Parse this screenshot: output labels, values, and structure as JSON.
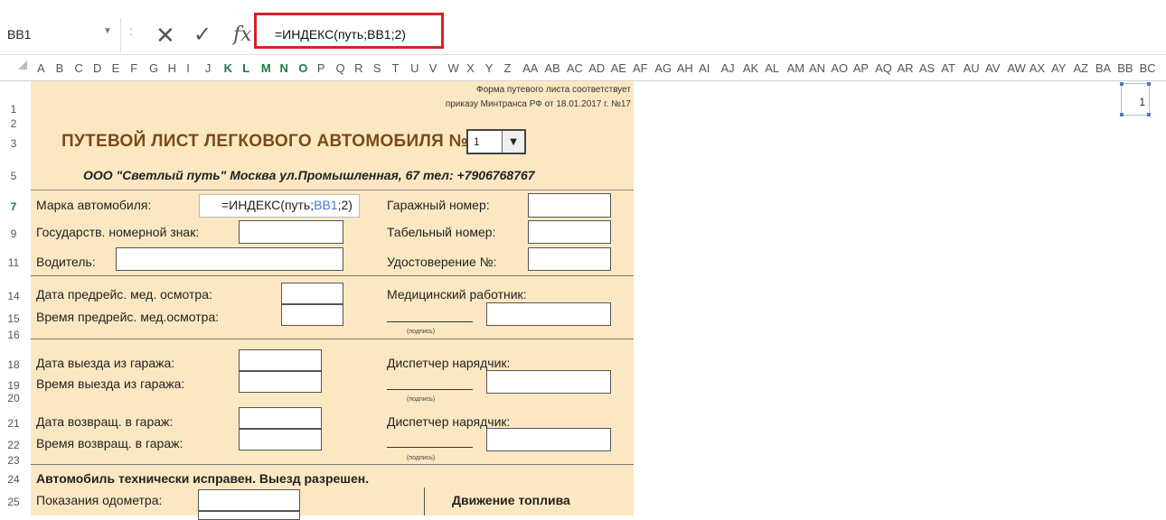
{
  "formula_bar": {
    "name_box": "BB1",
    "name_box_arrow": "▼",
    "separator": ":",
    "cancel_icon": "✕",
    "enter_icon": "✓",
    "fx_label": "fx",
    "formula": "=ИНДЕКС(путь;BB1;2)"
  },
  "columns": [
    "A",
    "B",
    "C",
    "D",
    "E",
    "F",
    "G",
    "H",
    "I",
    "J",
    "K",
    "L",
    "M",
    "N",
    "O",
    "P",
    "Q",
    "R",
    "S",
    "T",
    "U",
    "V",
    "W",
    "X",
    "Y",
    "Z",
    "AA",
    "AB",
    "AC",
    "AD",
    "AE",
    "AF",
    "AG",
    "AH",
    "AI",
    "AJ",
    "AK",
    "AL",
    "AM",
    "AN",
    "AO",
    "AP",
    "AQ",
    "AR",
    "AS",
    "AT",
    "AU",
    "AV",
    "AW",
    "AX",
    "AY",
    "AZ",
    "BA",
    "BB",
    "BC"
  ],
  "rows": [
    "1",
    "2",
    "3",
    "5",
    "7",
    "9",
    "11",
    "14",
    "15",
    "16",
    "18",
    "19",
    "20",
    "21",
    "22",
    "23",
    "24",
    "25"
  ],
  "sheet": {
    "form_note_line1": "Форма путевого листа соответствует",
    "form_note_line2": "приказу Минтранса РФ от 18.01.2017 г. №17",
    "title": "ПУТЕВОЙ ЛИСТ ЛЕГКОВОГО АВТОМОБИЛЯ  №",
    "trip_number": "1",
    "dropdown_icon": "▼",
    "company": "ООО \"Светлый путь\" Москва ул.Промышленная, 67  тел: +7906768767",
    "labels": {
      "car_brand": "Марка автомобиля:",
      "reg_number": "Государств. номерной знак:",
      "driver": "Водитель:",
      "garage_number": "Гаражный номер:",
      "tab_number": "Табельный номер:",
      "license": "Удостоверение №:",
      "med_date": "Дата предрейс. мед. осмотра:",
      "med_time": "Время предрейс. мед.осмотра:",
      "med_worker": "Медицинский работник:",
      "signature": "(подпись)",
      "leave_date": "Дата выезда из гаража:",
      "leave_time": "Время выезда из гаража:",
      "dispatcher1": "Диспетчер нарядчик:",
      "return_date": "Дата возвращ. в гараж:",
      "return_time": "Время возвращ. в гараж:",
      "dispatcher2": "Диспетчер нарядчик:",
      "car_ok": "Автомобиль технически исправен. Выезд разрешен.",
      "odometer": "Показания одометра:",
      "fuel_movement": "Движение топлива"
    },
    "active_cell_formula_pre": "=ИНДЕКС(путь;",
    "active_cell_formula_ref": "BB1",
    "active_cell_formula_post": ";2)"
  },
  "bb1_value": "1",
  "colors": {
    "sheet_bg": "#fbe8c2",
    "title": "#7a4a19",
    "highlight_border": "#d92027",
    "selected_header": "#1f7a45"
  }
}
